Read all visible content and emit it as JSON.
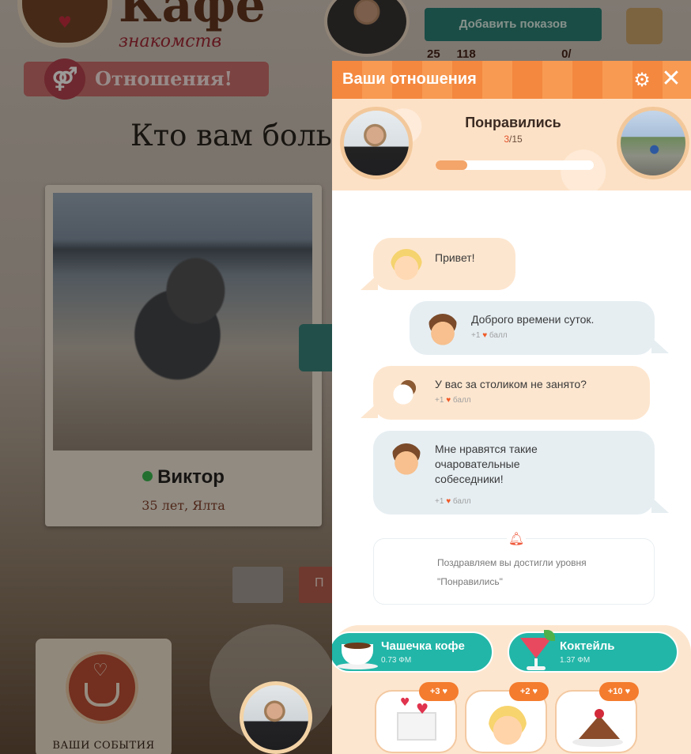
{
  "background": {
    "logo": {
      "title": "Кафе",
      "subtitle": "знакомств"
    },
    "ribbon_label": "Отношения!",
    "question": "Кто вам боль",
    "add_shows_button": "Добавить показов",
    "stats": {
      "likes": "25",
      "rating": "118",
      "messages": "0/"
    },
    "profile_card": {
      "name": "Виктор",
      "details": "35 лет, Ялта",
      "online": true
    },
    "next_button_partial": "П",
    "events_label": "ВАШИ СОБЫТИЯ"
  },
  "modal": {
    "title": "Ваши отношения",
    "level": {
      "name": "Понравились",
      "current": "3",
      "total": "/15",
      "progress_fraction": 0.2
    },
    "messages": [
      {
        "side": "left",
        "style": "peach",
        "avatar": "blonde-girl-wink",
        "text": "Привет!",
        "points": ""
      },
      {
        "side": "right",
        "style": "blue",
        "avatar": "boy-smile",
        "text": "Доброго времени суток.",
        "points": "+1",
        "points_unit": "балл"
      },
      {
        "side": "left",
        "style": "peach",
        "avatar": "coffee-cups",
        "text": "У вас за столиком не занято?",
        "points": "+1",
        "points_unit": "балл"
      },
      {
        "side": "left",
        "style": "blue",
        "avatar": "boy-smile",
        "text_lines": [
          "Мне нравятся такие",
          "очаровательные",
          "собеседники!"
        ],
        "points": "+1",
        "points_unit": "балл"
      }
    ],
    "notification": {
      "line1": "Поздравляем вы достигли уровня",
      "line2": "\"Понравились\""
    },
    "gift_buttons": [
      {
        "name": "Чашечка кофе",
        "price": "0.73 ФМ",
        "icon": "coffee-cup-icon"
      },
      {
        "name": "Коктейль",
        "price": "1.37 ФМ",
        "icon": "cocktail-icon"
      }
    ],
    "gift_cards": [
      {
        "badge": "+3",
        "icon": "love-letter-icon"
      },
      {
        "badge": "+2",
        "icon": "laughing-face-icon"
      },
      {
        "badge": "+10",
        "icon": "cake-slice-icon"
      }
    ]
  },
  "colors": {
    "header_orange": "#f4883f",
    "teal": "#22b6a8",
    "peach": "#fde6cf",
    "bubble_blue": "#e6eef2",
    "heart": "#f05a28"
  }
}
